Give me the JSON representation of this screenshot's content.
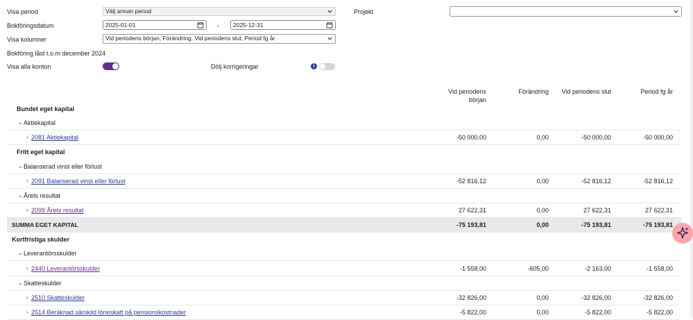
{
  "filters": {
    "visa_period_label": "Visa period",
    "visa_period_value": "Välj annan period",
    "bokforingsdatum_label": "Bokföringsdatum",
    "date_from": "2025-01-01",
    "date_separator": "-",
    "date_to": "2025-12-31",
    "visa_kolumner_label": "Visa kolumner",
    "visa_kolumner_value": "Vid periodens början, Förändring, Vid periodens slut, Period fg år",
    "locked_text": "Bokföring låst t.o.m december 2024",
    "visa_alla_konton_label": "Visa alla konton",
    "visa_alla_konton_on": true,
    "dolj_korrigeringar_label": "Dölj korrigeringar",
    "dolj_korrigeringar_on": false,
    "info_glyph": "i",
    "projekt_label": "Projekt",
    "projekt_value": ""
  },
  "table": {
    "columns": [
      "Vid periodens",
      "början",
      "Förändring",
      "Vid periodens slut",
      "Period fg år"
    ],
    "rows": [
      {
        "label": "Bundet eget kapital"
      },
      {
        "label": "Aktiekapital"
      },
      {
        "label": "2081 Aktiekapital",
        "values": [
          "-50 000,00",
          "0,00",
          "-50 000,00",
          "-50 000,00"
        ]
      },
      {
        "label": "Fritt eget kapital"
      },
      {
        "label": "Balanserad vinst eller förlust"
      },
      {
        "label": "2091 Balanserad vinst eller förlust",
        "values": [
          "-52 816,12",
          "0,00",
          "-52 816,12",
          "-52 816,12"
        ]
      },
      {
        "label": "Årets resultat"
      },
      {
        "label": "2099 Årets resultat",
        "values": [
          "27 622,31",
          "0,00",
          "27 622,31",
          "27 622,31"
        ]
      },
      {
        "label": "SUMMA EGET KAPITAL",
        "values": [
          "-75 193,81",
          "0,00",
          "-75 193,81",
          "-75 193,81"
        ]
      },
      {
        "label": "Kortfristiga skulder"
      },
      {
        "label": "Leverantörsskulder"
      },
      {
        "label": "2440 Leverantörsskulder",
        "values": [
          "-1 558,00",
          "-605,00",
          "-2 163,00",
          "-1 558,00"
        ]
      },
      {
        "label": "Skatteskulder"
      },
      {
        "label": "2510 Skatteskulder",
        "values": [
          "-32 826,00",
          "0,00",
          "-32 826,00",
          "-32 826,00"
        ]
      },
      {
        "label": "2514 Beräknad särskild löneskatt på pensionskostnader",
        "values": [
          "-5 822,00",
          "0,00",
          "-5 822,00",
          "-5 822,00"
        ]
      }
    ]
  },
  "icons": {
    "expand_glyph": "›",
    "collapse_glyph": "⌄",
    "ai_button": "sparkle-icon"
  },
  "colors": {
    "toggle_on": "#6a2b8f",
    "link": "#2c3aa0",
    "ai_button_bg": "#f7a7a7"
  }
}
